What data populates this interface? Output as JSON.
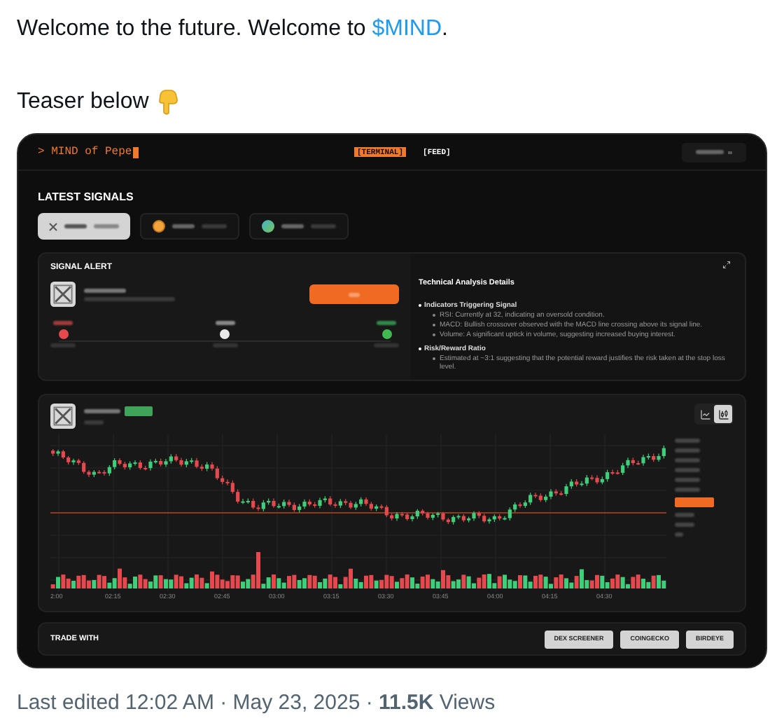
{
  "tweet": {
    "line1": "Welcome to the future. Welcome to ",
    "cashtag": "$MIND",
    "line1_end": ".",
    "line2": "Teaser below"
  },
  "terminal": {
    "brand": "> MIND of Pepe",
    "nav": [
      {
        "label": "[TERMINAL]",
        "selected": true
      },
      {
        "label": "[FEED]",
        "selected": false
      }
    ],
    "section_title": "LATEST SIGNALS",
    "signal_tabs": [
      {
        "kind": "x",
        "selected": true
      },
      {
        "kind": "coin",
        "selected": false
      },
      {
        "kind": "globe",
        "selected": false
      }
    ],
    "signal_alert": {
      "title": "SIGNAL ALERT",
      "markers": [
        {
          "color": "#e5484d"
        },
        {
          "color": "#e8e8e8"
        },
        {
          "color": "#3fb950"
        }
      ]
    },
    "analysis": {
      "title": "Technical Analysis Details",
      "sections": [
        {
          "heading": "Indicators Triggering Signal",
          "bullets": [
            "RSI: Currently at 32, indicating an oversold condition.",
            "MACD: Bullish crossover observed with the MACD line crossing above its signal line.",
            "Volume: A significant uptick in volume, suggesting increased buying interest."
          ]
        },
        {
          "heading": "Risk/Reward Ratio",
          "bullets": [
            "Estimated at ~3:1 suggesting that the potential reward justifies the risk taken at the stop loss level."
          ]
        }
      ]
    },
    "chart": {
      "x_ticks": [
        "2:00",
        "02:15",
        "02:30",
        "02:45",
        "03:00",
        "03:15",
        "03:30",
        "03:45",
        "04:00",
        "04:15",
        "04:30"
      ],
      "modes": [
        {
          "kind": "line",
          "selected": false
        },
        {
          "kind": "candles",
          "selected": true
        }
      ]
    },
    "trade": {
      "label": "TRADE WITH",
      "buttons": [
        "DEX SCREENER",
        "COINGECKO",
        "BIRDEYE"
      ]
    }
  },
  "footer": {
    "text": "Last edited 12:02 AM · May 23, 2025 · **11.5K** Views"
  }
}
